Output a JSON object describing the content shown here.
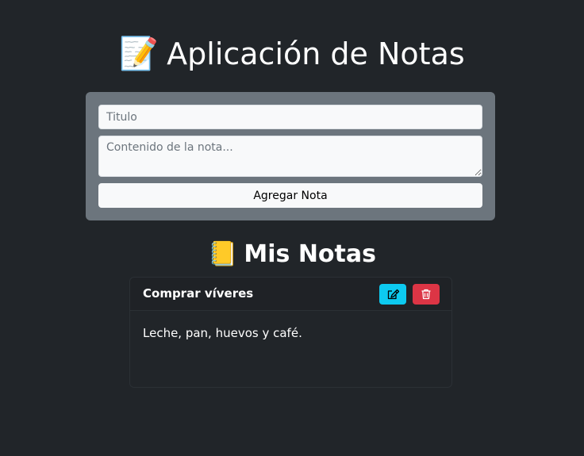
{
  "header": {
    "emoji": "📝",
    "title": "Aplicación de Notas"
  },
  "form": {
    "title_placeholder": "Titulo",
    "content_placeholder": "Contenido de la nota...",
    "add_button_label": "Agregar Nota"
  },
  "notes_section": {
    "emoji": "📒",
    "title": "Mis Notas"
  },
  "notes": [
    {
      "title": "Comprar víveres",
      "content": "Leche, pan, huevos y café.",
      "edit_icon": "pencil-square-icon",
      "delete_icon": "trash-icon"
    }
  ],
  "colors": {
    "background": "#212529",
    "form_card": "#6c757d",
    "edit_button": "#0dcaf0",
    "delete_button": "#dc3545"
  }
}
